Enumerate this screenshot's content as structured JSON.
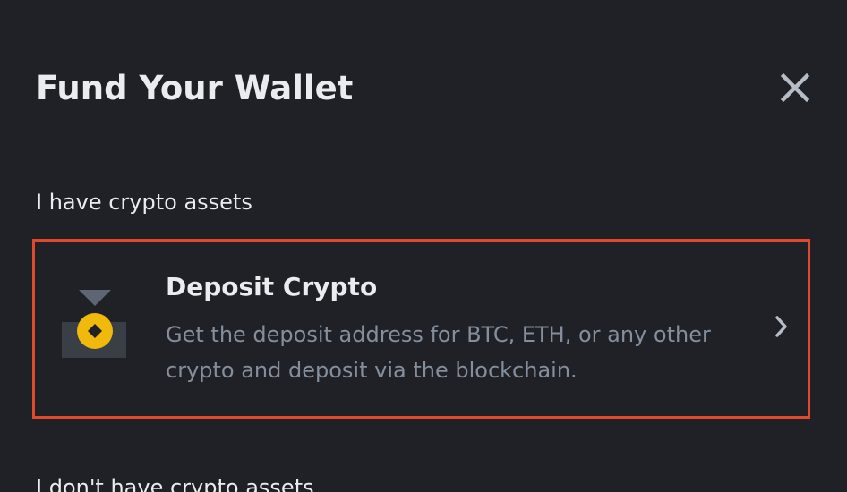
{
  "dialog": {
    "title": "Fund Your Wallet",
    "close_icon": "close-icon"
  },
  "sections": [
    {
      "label": "I have crypto assets",
      "options": [
        {
          "title": "Deposit Crypto",
          "description": "Get the deposit address for BTC, ETH, or any other crypto and deposit via the blockchain.",
          "icon": "deposit-crypto-icon",
          "chevron_icon": "chevron-right-icon"
        }
      ]
    },
    {
      "label": "I don't have crypto assets"
    }
  ],
  "colors": {
    "background": "#1f2126",
    "primary_text": "#eaecef",
    "secondary_text": "#848e9c",
    "accent": "#f0b90b",
    "highlight_border": "#e04a2c"
  }
}
